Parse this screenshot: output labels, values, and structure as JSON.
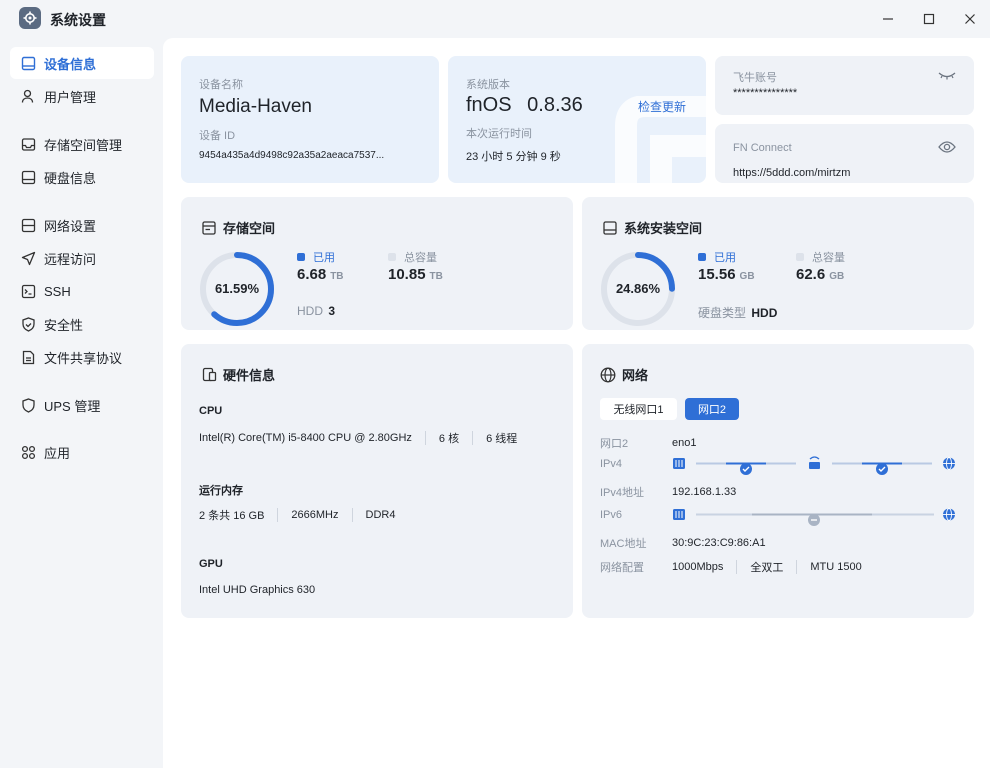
{
  "window": {
    "title": "系统设置"
  },
  "sidebar": {
    "items": [
      {
        "label": "设备信息",
        "icon": "monitor-icon"
      },
      {
        "label": "用户管理",
        "icon": "user-icon"
      },
      {
        "label": "存储空间管理",
        "icon": "storage-icon"
      },
      {
        "label": "硬盘信息",
        "icon": "disk-icon"
      },
      {
        "label": "网络设置",
        "icon": "network-icon"
      },
      {
        "label": "远程访问",
        "icon": "send-icon"
      },
      {
        "label": "SSH",
        "icon": "terminal-icon"
      },
      {
        "label": "安全性",
        "icon": "shield-check-icon"
      },
      {
        "label": "文件共享协议",
        "icon": "file-icon"
      },
      {
        "label": "UPS 管理",
        "icon": "shield-icon"
      },
      {
        "label": "应用",
        "icon": "apps-icon"
      }
    ]
  },
  "device": {
    "name_label": "设备名称",
    "name": "Media-Haven",
    "id_label": "设备 ID",
    "id": "9454a435a4d9498c92a35a2aeaca7537..."
  },
  "system": {
    "version_label": "系统版本",
    "os": "fnOS",
    "version": "0.8.36",
    "check_update": "检查更新",
    "uptime_label": "本次运行时间",
    "uptime": "23 小时 5 分钟 9 秒"
  },
  "account": {
    "label": "飞牛账号",
    "value": "***************"
  },
  "fn_connect": {
    "label": "FN Connect",
    "value": "https://5ddd.com/mirtzm"
  },
  "storage": {
    "title": "存储空间",
    "percent": "61.59%",
    "percent_value": 61.59,
    "used_label": "已用",
    "used": "6.68",
    "used_unit": "TB",
    "total_label": "总容量",
    "total": "10.85",
    "total_unit": "TB",
    "hdd_label": "HDD",
    "hdd_count": "3"
  },
  "sys_storage": {
    "title": "系统安装空间",
    "percent": "24.86%",
    "percent_value": 24.86,
    "used_label": "已用",
    "used": "15.56",
    "used_unit": "GB",
    "total_label": "总容量",
    "total": "62.6",
    "total_unit": "GB",
    "disk_type_label": "硬盘类型",
    "disk_type": "HDD"
  },
  "hardware": {
    "title": "硬件信息",
    "cpu_label": "CPU",
    "cpu_model": "Intel(R) Core(TM) i5-8400 CPU @ 2.80GHz",
    "cpu_cores": "6 核",
    "cpu_threads": "6 线程",
    "mem_label": "运行内存",
    "mem_size": "2 条共 16 GB",
    "mem_speed": "2666MHz",
    "mem_type": "DDR4",
    "gpu_label": "GPU",
    "gpu_model": "Intel UHD Graphics 630"
  },
  "network": {
    "title": "网络",
    "tabs": [
      "无线网口1",
      "网口2"
    ],
    "port_label": "网口2",
    "port_value": "eno1",
    "ipv4_label": "IPv4",
    "ipv4_addr_label": "IPv4地址",
    "ipv4_addr": "192.168.1.33",
    "ipv6_label": "IPv6",
    "mac_label": "MAC地址",
    "mac": "30:9C:23:C9:86:A1",
    "config_label": "网络配置",
    "speed": "1000Mbps",
    "duplex": "全双工",
    "mtu": "MTU 1500"
  },
  "colors": {
    "accent": "#2f6fd6",
    "ring_track": "#dde2ea",
    "card_bg": "#eff2f7"
  }
}
